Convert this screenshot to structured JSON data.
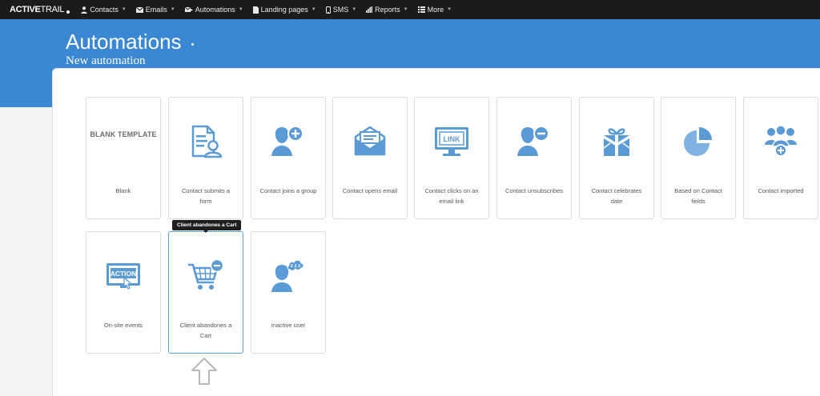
{
  "brand": {
    "logo_bold": "ACTIVE",
    "logo_light": "TRAIL"
  },
  "nav": [
    {
      "label": "Contacts",
      "icon": "person-icon"
    },
    {
      "label": "Emails",
      "icon": "envelope-icon"
    },
    {
      "label": "Automations",
      "icon": "automation-icon"
    },
    {
      "label": "Landing pages",
      "icon": "page-icon"
    },
    {
      "label": "SMS",
      "icon": "mobile-icon"
    },
    {
      "label": "Reports",
      "icon": "bar-chart-icon"
    },
    {
      "label": "More",
      "icon": "list-icon"
    }
  ],
  "header": {
    "title": "Automations",
    "subtitle": "New automation"
  },
  "cards": [
    {
      "label": "Blank",
      "header_text": "BLANK TEMPLATE",
      "icon": "blank-template"
    },
    {
      "label": "Contact submits a form",
      "icon": "form-icon"
    },
    {
      "label": "Contact joins a group",
      "icon": "user-plus-icon"
    },
    {
      "label": "Contact opens email",
      "icon": "open-envelope-icon"
    },
    {
      "label": "Contact clicks on an email link",
      "icon": "link-monitor-icon"
    },
    {
      "label": "Contact unsubscribes",
      "icon": "user-minus-icon"
    },
    {
      "label": "Contact celebrates date",
      "icon": "gift-icon"
    },
    {
      "label": "Based on Contact fields",
      "icon": "pie-chart-icon"
    },
    {
      "label": "Contact imported",
      "icon": "users-import-icon"
    },
    {
      "label": "On-site events",
      "icon": "action-click-icon"
    },
    {
      "label": "Client abandones a Cart",
      "icon": "cart-minus-icon"
    },
    {
      "label": "Inactive user",
      "icon": "user-sleep-icon"
    }
  ],
  "tooltip": "Client abandones a Cart",
  "colors": {
    "accent": "#3a88d4",
    "icon_blue": "#5b9bd5",
    "nav_bg": "#1b1b1b"
  }
}
